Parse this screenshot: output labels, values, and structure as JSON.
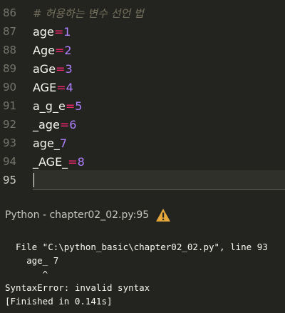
{
  "editor": {
    "lines": [
      {
        "num": "86",
        "comment": "# 허용하는 변수 선언 법"
      },
      {
        "num": "87",
        "name": "age",
        "op": "=",
        "value": "1"
      },
      {
        "num": "88",
        "name": "Age",
        "op": "=",
        "value": "2"
      },
      {
        "num": "89",
        "name": "aGe",
        "op": "=",
        "value": "3"
      },
      {
        "num": "90",
        "name": "AGE",
        "op": "=",
        "value": "4"
      },
      {
        "num": "91",
        "name": "a_g_e",
        "op": "=",
        "value": "5"
      },
      {
        "num": "92",
        "name": "_age",
        "op": "=",
        "value": "6"
      },
      {
        "num": "93",
        "name": "age_",
        "op": "",
        "value": "7"
      },
      {
        "num": "94",
        "name": "_AGE_",
        "op": "=",
        "value": "8"
      },
      {
        "num": "95"
      }
    ]
  },
  "panel": {
    "title": "Python - chapter02_02.py:95",
    "status_icon": "warning-icon",
    "warning_color": "#e4a83c"
  },
  "output": {
    "lines": [
      "  File \"C:\\python_basic\\chapter02_02.py\", line 93",
      "    age_ 7",
      "       ^",
      "SyntaxError: invalid syntax",
      "[Finished in 0.141s]"
    ]
  }
}
